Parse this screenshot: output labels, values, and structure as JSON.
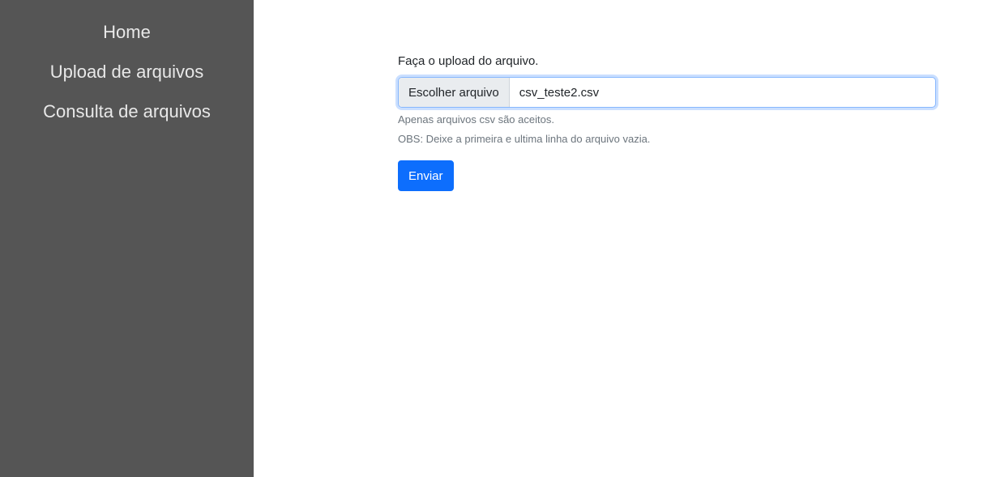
{
  "sidebar": {
    "items": [
      {
        "label": "Home"
      },
      {
        "label": "Upload de arquivos"
      },
      {
        "label": "Consulta de arquivos"
      }
    ]
  },
  "form": {
    "label": "Faça o upload do arquivo.",
    "file_button_label": "Escolher arquivo",
    "file_name": "csv_teste2.csv",
    "help_text_1": "Apenas arquivos csv são aceitos.",
    "help_text_2": "OBS: Deixe a primeira e ultima linha do arquivo vazia.",
    "submit_label": "Enviar"
  },
  "colors": {
    "sidebar_bg": "#555555",
    "primary": "#0d6efd"
  }
}
